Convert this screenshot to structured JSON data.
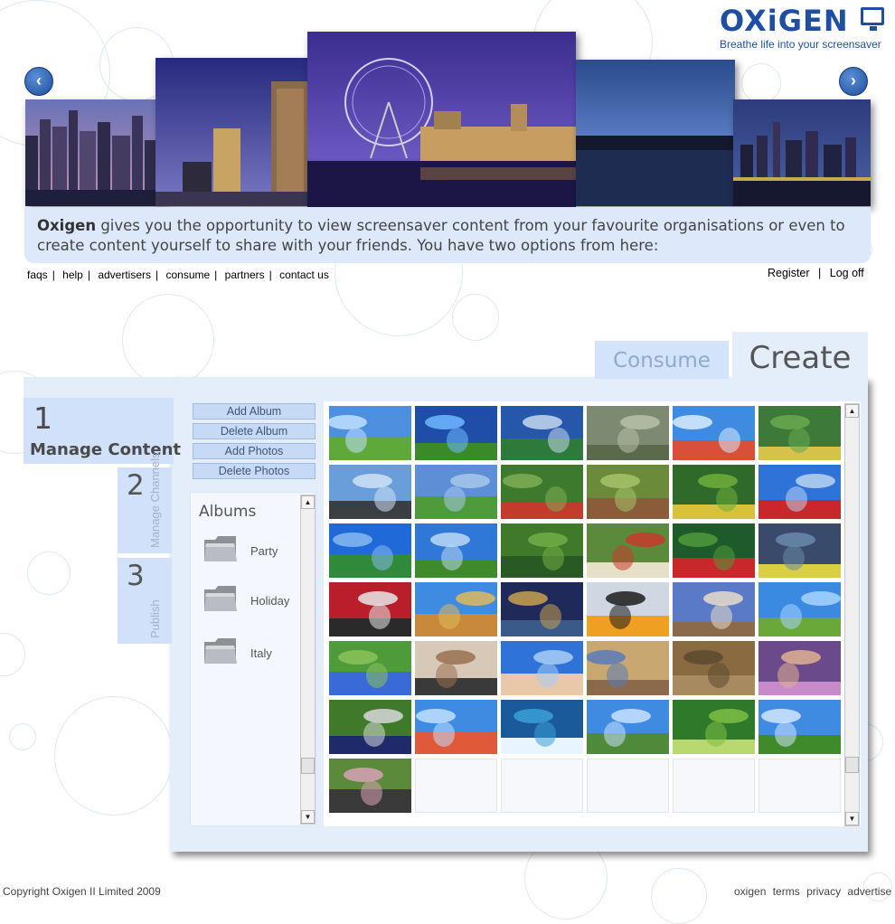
{
  "brand": {
    "logo_text": "OXiGEN",
    "tagline": "Breathe life into your screensaver",
    "primary_color": "#1f4fa3"
  },
  "carousel": {
    "prev_icon": "chevron-left-icon",
    "next_icon": "chevron-right-icon",
    "prev_glyph": "‹",
    "next_glyph": "›"
  },
  "intro": {
    "brand_word": "Oxigen",
    "text": " gives you the opportunity to view screensaver content from your favourite organisations or even to create content yourself to share with your friends. You have two options from here:"
  },
  "nav": {
    "links": [
      "faqs",
      "help",
      "advertisers",
      "consume",
      "partners",
      "contact us"
    ],
    "register": "Register",
    "logoff": "Log off"
  },
  "tabs": {
    "consume": "Consume",
    "create": "Create"
  },
  "steps": {
    "step1": {
      "number": "1",
      "label": "Manage Content"
    },
    "step2": {
      "number": "2",
      "label": "Manage Channels"
    },
    "step3": {
      "number": "3",
      "label": "Publish"
    }
  },
  "actions": {
    "add_album": "Add Album",
    "delete_album": "Delete Album",
    "add_photos": "Add Photos",
    "delete_photos": "Delete Photos"
  },
  "albums": {
    "title": "Albums",
    "items": [
      "Party",
      "Holiday",
      "Italy"
    ]
  },
  "scroll_glyphs": {
    "up": "▲",
    "down": "▼"
  },
  "footer": {
    "copyright": "Copyright Oxigen II Limited 2009",
    "links": [
      "oxigen",
      "terms",
      "privacy",
      "advertise"
    ]
  }
}
